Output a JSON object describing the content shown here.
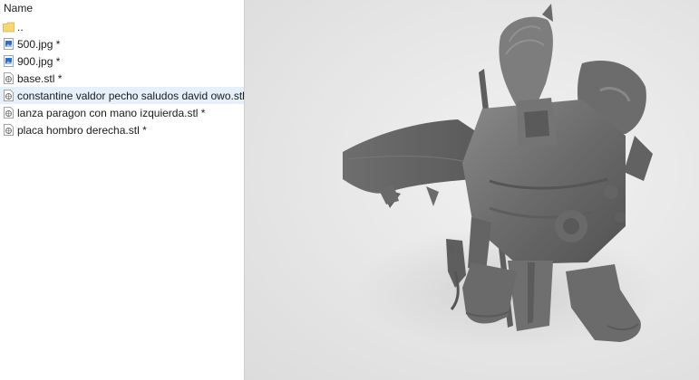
{
  "file_browser": {
    "column_header": "Name",
    "files": [
      {
        "name": "..",
        "icon": "folder-icon",
        "selected": false
      },
      {
        "name": "500.jpg *",
        "icon": "image-file-icon",
        "selected": false
      },
      {
        "name": "900.jpg *",
        "icon": "image-file-icon",
        "selected": false
      },
      {
        "name": "base.stl *",
        "icon": "stl-file-icon",
        "selected": false
      },
      {
        "name": "constantine valdor pecho saludos david owo.stl",
        "icon": "stl-file-icon",
        "selected": true
      },
      {
        "name": "lanza paragon con mano izquierda.stl *",
        "icon": "stl-file-icon",
        "selected": false
      },
      {
        "name": "placa hombro derecha.stl *",
        "icon": "stl-file-icon",
        "selected": false
      }
    ]
  },
  "viewer": {
    "model_icon": "3d-miniature-model",
    "background_color": "#e8e8e8",
    "model_color": "#6e6e6e",
    "selection_color": "#e5f0fb"
  }
}
